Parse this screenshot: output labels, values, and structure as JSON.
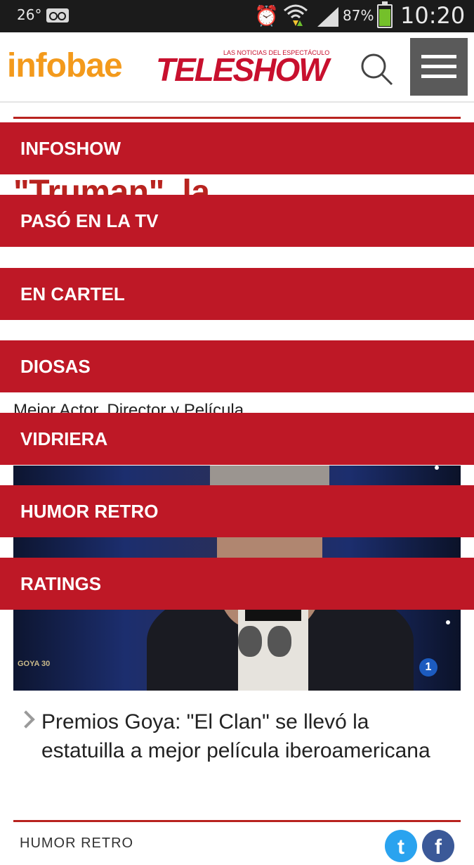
{
  "status_bar": {
    "temperature": "26°",
    "battery_percent": "87%",
    "battery_level": 0.87,
    "time": "10:20"
  },
  "header": {
    "logo_infobae": "infobae",
    "logo_teleshow": "TELESHOW",
    "logo_tagline": "LAS NOTICIAS DEL ESPECTÁCULO"
  },
  "article": {
    "headline": "\"Truman\", la\nganadora de los Premios",
    "subtitle": "Mejor Actor, Director y Película",
    "photo_watermark_goya": "GOYA 30",
    "photo_channel_logo": "1",
    "related_link": "Premios Goya: \"El Clan\" se llevó la estatuilla a mejor película iberoamericana",
    "next_section_label": "HUMOR RETRO",
    "share_twitter_glyph": "t",
    "share_facebook_glyph": "f"
  },
  "menu": {
    "items": [
      {
        "label": "INFOSHOW"
      },
      {
        "label": "PASÓ EN LA TV"
      },
      {
        "label": "EN CARTEL"
      },
      {
        "label": "DIOSAS"
      },
      {
        "label": "VIDRIERA"
      },
      {
        "label": "HUMOR RETRO"
      },
      {
        "label": "RATINGS"
      }
    ]
  },
  "colors": {
    "brand_red": "#be1826",
    "infobae_orange": "#f39a1c",
    "headline_red": "#b8231f"
  }
}
